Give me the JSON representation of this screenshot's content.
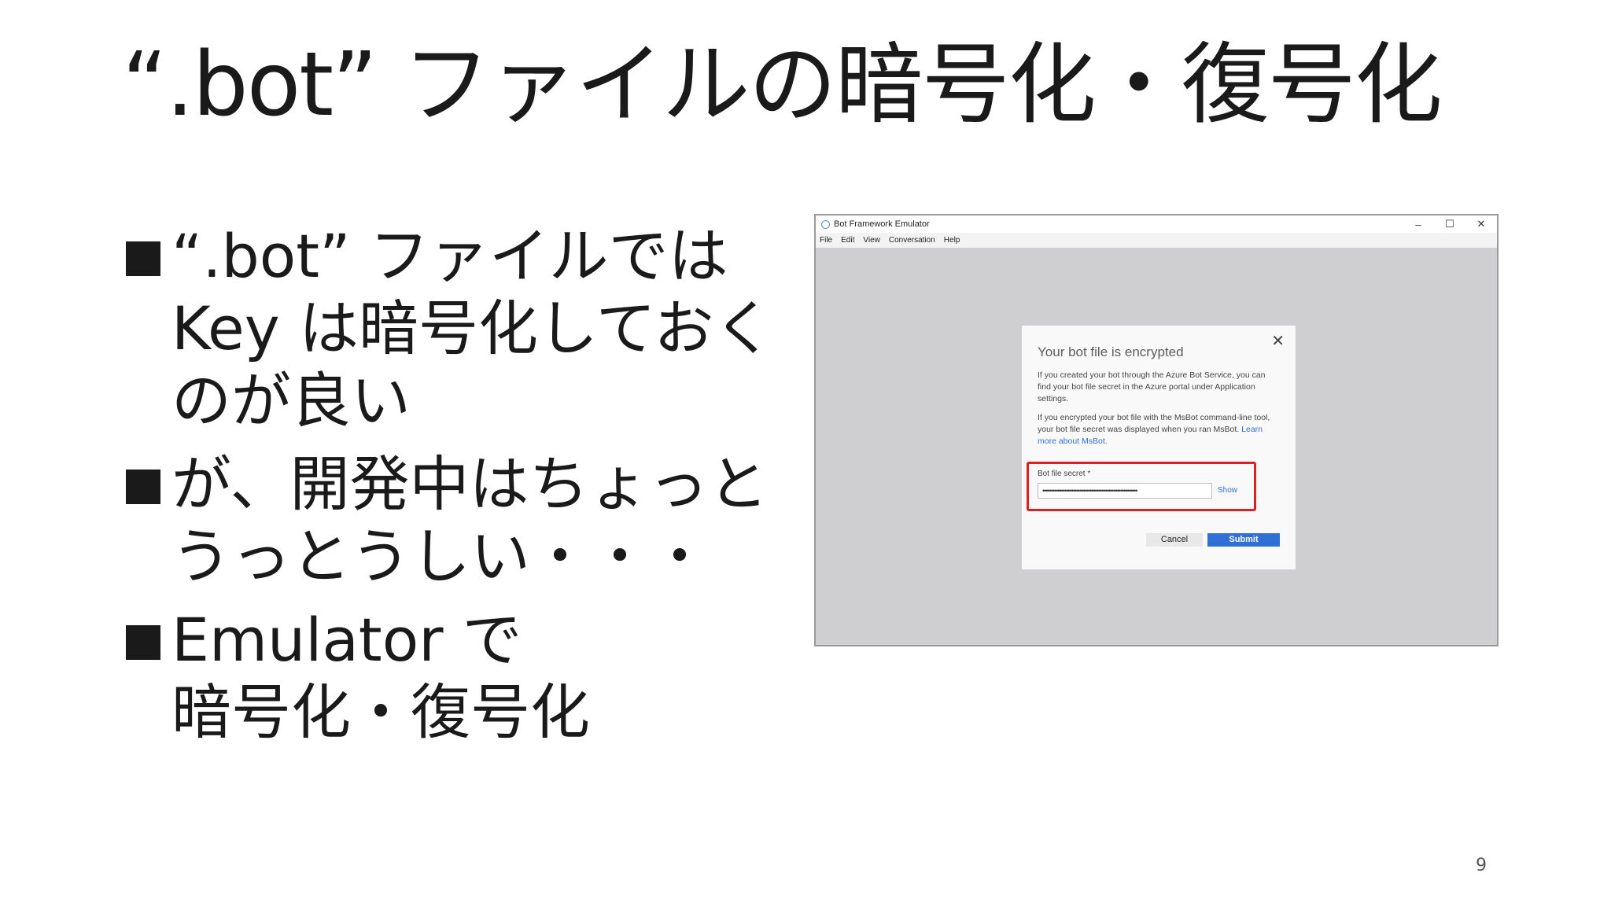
{
  "slide": {
    "title": "“.bot” ファイルの暗号化・復号化",
    "bullets": [
      {
        "lines": [
          "“.bot” ファイルでは",
          "Key は暗号化しておく",
          "のが良い"
        ]
      },
      {
        "lines": [
          "が、開発中はちょっと",
          "うっとうしい・・・"
        ]
      },
      {
        "lines": [
          "Emulator で",
          "暗号化・復号化"
        ]
      }
    ],
    "page_number": "9"
  },
  "emulator": {
    "window_title": "Bot Framework Emulator",
    "controls": {
      "minimize": "–",
      "maximize": "☐",
      "close": "✕"
    },
    "menu": [
      "File",
      "Edit",
      "View",
      "Conversation",
      "Help"
    ],
    "dialog": {
      "close_glyph": "✕",
      "heading": "Your bot file is encrypted",
      "paragraph1": "If you created your bot through the Azure Bot Service, you can find your bot file secret in the Azure portal under Application settings.",
      "paragraph2": "If you encrypted your bot file with the MsBot command-line tool, your bot file secret was displayed when you ran MsBot.",
      "learn_more": "Learn more about MsBot.",
      "secret_label": "Bot file secret *",
      "secret_value": "••••••••••••••••••••••••••••••••••••••••••••••••••••••••",
      "show_label": "Show",
      "cancel_label": "Cancel",
      "submit_label": "Submit"
    }
  }
}
